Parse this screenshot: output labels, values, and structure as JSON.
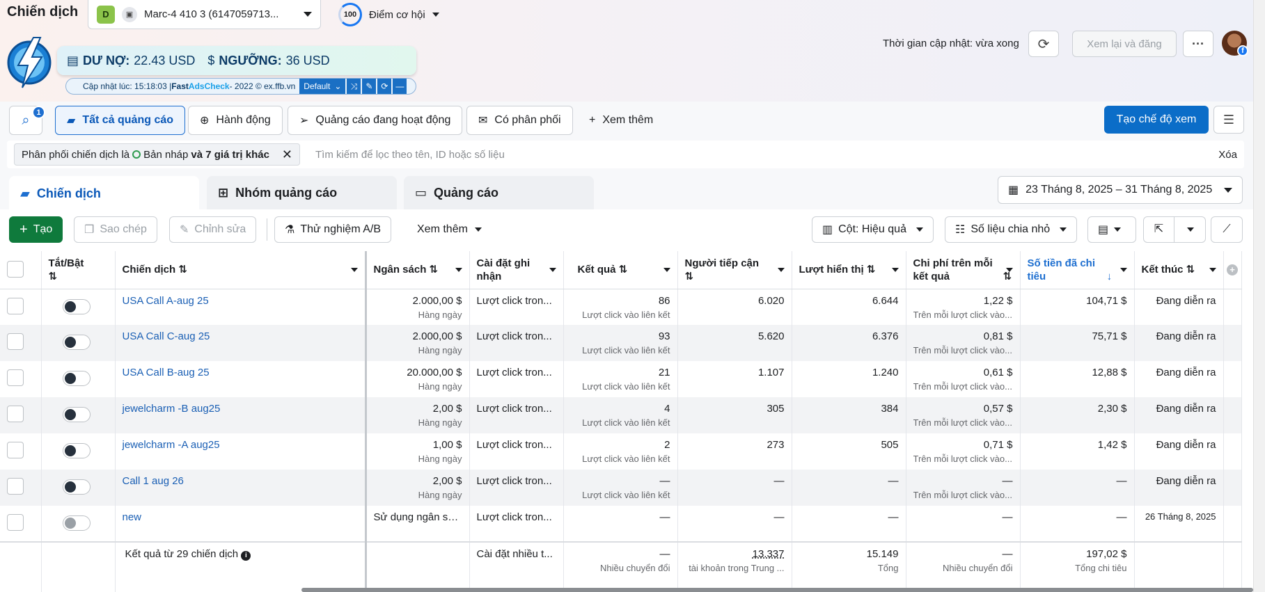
{
  "header": {
    "title": "Chiến dịch",
    "account_badge": "D",
    "account_name": "Marc-4 410 3 (6147059713...",
    "score_value": "100",
    "score_label": "Điểm cơ hội",
    "update_text": "Thời gian cập nhật: vừa xong",
    "review_label": "Xem lại và đăng",
    "more_label": "···",
    "avatar_badge": "f"
  },
  "extension": {
    "debt_label": "DƯ NỢ:",
    "debt_value": "22.43 USD",
    "threshold_label": "NGƯỠNG:",
    "threshold_value": "36 USD",
    "updated": "Cập nhật lúc: 15:18:03 | ",
    "brand_fast": "Fast ",
    "brand_name": "AdsCheck",
    "footer": " - 2022 © ex.ffb.vn",
    "select_value": "Default"
  },
  "filters": {
    "search_badge": "1",
    "chips": [
      {
        "label": "Tất cả quảng cáo"
      },
      {
        "label": "Hành động"
      },
      {
        "label": "Quảng cáo đang hoạt động"
      },
      {
        "label": "Có phân phối"
      },
      {
        "label": "Xem thêm"
      }
    ],
    "create_view": "Tạo chế độ xem",
    "pill_text": "Phân phối chiến dịch là",
    "pill_value": "Bản nháp",
    "pill_more": "và 7 giá trị khác",
    "search_placeholder": "Tìm kiếm để lọc theo tên, ID hoặc số liệu",
    "clear": "Xóa"
  },
  "level_tabs": [
    {
      "label": "Chiến dịch"
    },
    {
      "label": "Nhóm quảng cáo"
    },
    {
      "label": "Quảng cáo"
    }
  ],
  "date_range": "23 Tháng 8, 2025 – 31 Tháng 8, 2025",
  "toolbar": {
    "create": "Tạo",
    "copy": "Sao chép",
    "edit": "Chỉnh sửa",
    "ab_test": "Thử nghiệm A/B",
    "more": "Xem thêm",
    "columns": "Cột: Hiệu quả",
    "breakdown": "Số liệu chia nhỏ"
  },
  "table": {
    "headers": {
      "toggle": "Tắt/Bật",
      "campaign": "Chiến dịch",
      "budget": "Ngân sách",
      "attribution": "Cài đặt ghi nhận",
      "results": "Kết quả",
      "reach": "Người tiếp cận",
      "impressions": "Lượt hiển thị",
      "cpr": "Chi phí trên mỗi kết quả",
      "spent": "Số tiền đã chi tiêu",
      "ends": "Kết thúc"
    },
    "rows": [
      {
        "name": "USA Call A-aug 25",
        "budget": "2.000,00 $",
        "budget_sub": "Hàng ngày",
        "attr": "Lượt click tron...",
        "results": "86",
        "results_sub": "Lượt click vào liên kết",
        "reach": "6.020",
        "impr": "6.644",
        "cpr": "1,22 $",
        "cpr_sub": "Trên mỗi lượt click vào...",
        "spent": "104,71 $",
        "ends": "Đang diễn ra",
        "on": true
      },
      {
        "name": "USA Call C-aug 25",
        "budget": "2.000,00 $",
        "budget_sub": "Hàng ngày",
        "attr": "Lượt click tron...",
        "results": "93",
        "results_sub": "Lượt click vào liên kết",
        "reach": "5.620",
        "impr": "6.376",
        "cpr": "0,81 $",
        "cpr_sub": "Trên mỗi lượt click vào...",
        "spent": "75,71 $",
        "ends": "Đang diễn ra",
        "on": true
      },
      {
        "name": "USA Call B-aug 25",
        "budget": "20.000,00 $",
        "budget_sub": "Hàng ngày",
        "attr": "Lượt click tron...",
        "results": "21",
        "results_sub": "Lượt click vào liên kết",
        "reach": "1.107",
        "impr": "1.240",
        "cpr": "0,61 $",
        "cpr_sub": "Trên mỗi lượt click vào...",
        "spent": "12,88 $",
        "ends": "Đang diễn ra",
        "on": true
      },
      {
        "name": "jewelcharm -B aug25",
        "budget": "2,00 $",
        "budget_sub": "Hàng ngày",
        "attr": "Lượt click tron...",
        "results": "4",
        "results_sub": "Lượt click vào liên kết",
        "reach": "305",
        "impr": "384",
        "cpr": "0,57 $",
        "cpr_sub": "Trên mỗi lượt click vào...",
        "spent": "2,30 $",
        "ends": "Đang diễn ra",
        "on": true
      },
      {
        "name": "jewelcharm -A aug25",
        "budget": "1,00 $",
        "budget_sub": "Hàng ngày",
        "attr": "Lượt click tron...",
        "results": "2",
        "results_sub": "Lượt click vào liên kết",
        "reach": "273",
        "impr": "505",
        "cpr": "0,71 $",
        "cpr_sub": "Trên mỗi lượt click vào...",
        "spent": "1,42 $",
        "ends": "Đang diễn ra",
        "on": true
      },
      {
        "name": "Call 1 aug 26",
        "budget": "2,00 $",
        "budget_sub": "Hàng ngày",
        "attr": "Lượt click tron...",
        "results": "—",
        "results_sub": "Lượt click vào liên kết",
        "reach": "—",
        "impr": "—",
        "cpr": "—",
        "cpr_sub": "Trên mỗi lượt click vào...",
        "spent": "—",
        "ends": "Đang diễn ra",
        "on": true
      },
      {
        "name": "new",
        "budget": "Sử dụng ngân sá...",
        "budget_sub": "",
        "attr": "Lượt click tron...",
        "results": "—",
        "results_sub": "",
        "reach": "—",
        "impr": "—",
        "cpr": "—",
        "cpr_sub": "",
        "spent": "—",
        "ends": "26 Tháng 8, 2025",
        "on": false
      }
    ],
    "summary": {
      "label": "Kết quả từ 29 chiến dịch",
      "attr": "Cài đặt nhiều t...",
      "results": "—",
      "results_sub": "Nhiều chuyển đổi",
      "reach": "13.337",
      "reach_sub": "tài khoản trong Trung ...",
      "impr": "15.149",
      "impr_sub": "Tổng",
      "cpr": "—",
      "cpr_sub": "Nhiều chuyển đổi",
      "spent": "197,02 $",
      "spent_sub": "Tổng chi tiêu"
    }
  }
}
